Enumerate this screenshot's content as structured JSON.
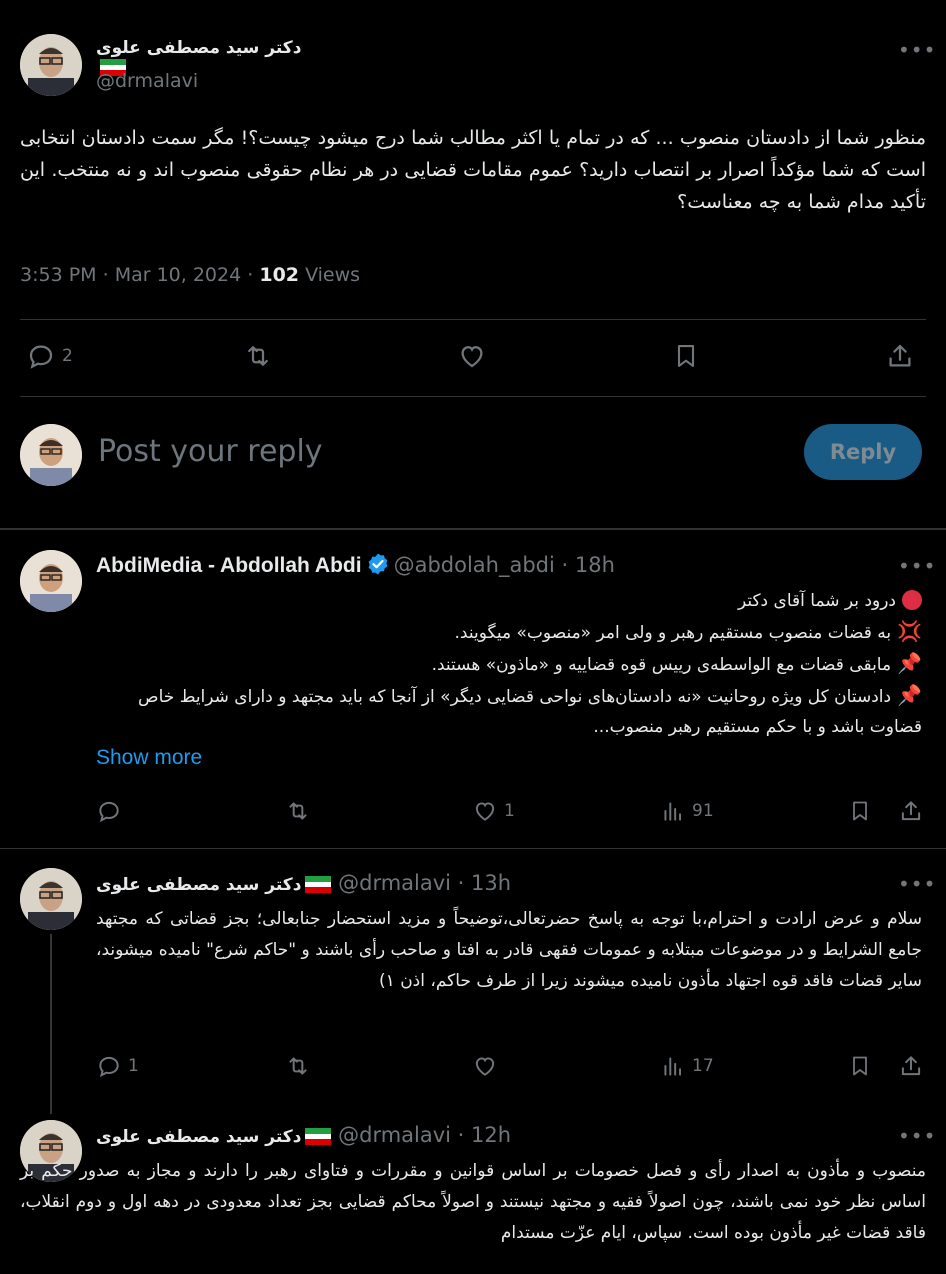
{
  "main_tweet": {
    "display_name": "دکتر سید مصطفی علوی",
    "handle": "@drmalavi",
    "body": "منظور شما از دادستان منصوب ... که در تمام یا اکثر مطالب شما درج میشود چیست؟! مگر سمت دادستان انتخابی است که شما مؤکداً اصرار بر انتصاب دارید؟ عموم مقامات قضایی در هر نظام حقوقی منصوب اند و نه منتخب. این تأکید مدام شما به چه معناست؟",
    "time": "3:53 PM",
    "date": "Mar 10, 2024",
    "views_count": "102",
    "views_label": "Views",
    "reply_count": "2"
  },
  "composer": {
    "placeholder": "Post your reply",
    "button": "Reply"
  },
  "replies": [
    {
      "display_name": "AbdiMedia - Abdollah Abdi",
      "handle": "@abdolah_abdi",
      "age": "18h",
      "lines": [
        "درود بر شما آقای دکتر",
        "به قضات منصوب مستقیم رهبر و ولی امر «منصوب» میگویند.",
        "مابقی قضات مع الواسطه‌ی رییس قوه قضاییه و «ماذون» هستند.",
        "دادستان کل ویژه روحانیت «نه دادستان‌های نواحی قضایی دیگر» از آنجا که باید مجتهد و دارای شرایط خاص قضاوت باشد و با حکم مستقیم رهبر منصوب..."
      ],
      "emojis": [
        "red-circle",
        "anger-symbol",
        "pushpin",
        "pushpin"
      ],
      "show_more": "Show more",
      "reply_count": "",
      "like_count": "1",
      "view_count": "91"
    },
    {
      "display_name": "دکتر سید مصطفی علوی",
      "handle": "@drmalavi",
      "age": "13h",
      "body": "سلام و عرض ارادت و احترام،با توجه به پاسخ حضرتعالی،توضیحاً و مزید استحضار جنابعالی؛ بجز قضاتی که مجتهد جامع الشرایط و در موضوعات مبتلابه و عمومات فقهی قادر به افتا و صاحب رأی باشند و \"حاکم شرع\" نامیده میشوند، سایر قضات فاقد قوه اجتهاد مأذون نامیده میشوند زیرا از طرف حاکم، اذن ۱)",
      "reply_count": "1",
      "like_count": "",
      "view_count": "17"
    },
    {
      "display_name": "دکتر سید مصطفی علوی",
      "handle": "@drmalavi",
      "age": "12h",
      "body": "منصوب و مأذون به اصدار رأی و فصل خصومات بر اساس قوانین و مقررات و فتاوای رهبر را دارند و مجاز به صدور حکم بر اساس نظر خود نمی باشند، چون اصولاً فقیه و مجتهد نیستند و اصولاً محاکم قضایی بجز تعداد معدودی در دهه اول و دوم انقلاب، فاقد قضات غیر مأذون بوده است. سپاس، ایام عزّت مستدام"
    }
  ],
  "colors": {
    "background": "#000000",
    "text": "#e7e9ea",
    "muted": "#71767b",
    "accent": "#1d9bf0",
    "divider": "#2f3336",
    "reply_button_bg": "#1a5b86",
    "reply_button_text": "#7f8b93"
  }
}
